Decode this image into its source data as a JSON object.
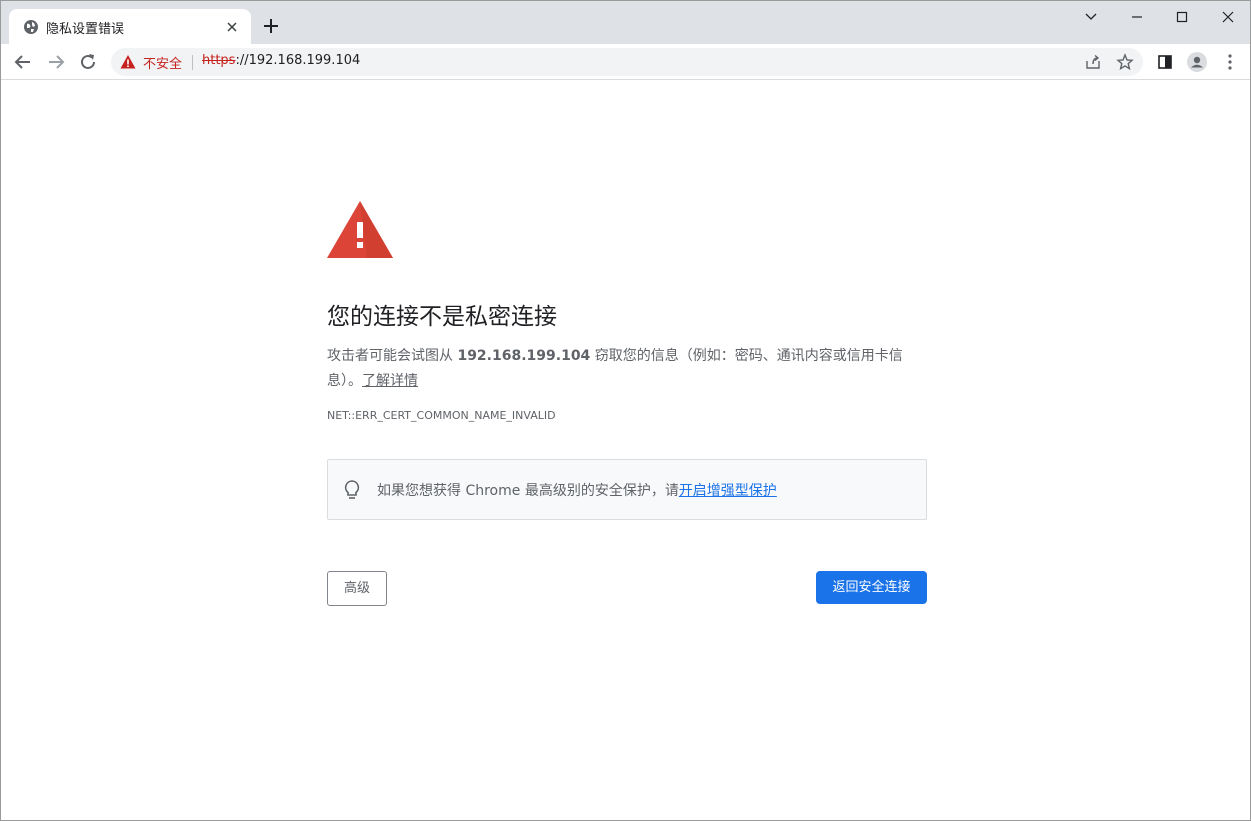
{
  "tab": {
    "title": "隐私设置错误",
    "favicon_icon": "globe-icon",
    "close_icon": "close-icon"
  },
  "window_controls": [
    "chevron-down-icon",
    "minimize-icon",
    "maximize-icon",
    "close-icon"
  ],
  "toolbar": {
    "security_label": "不安全",
    "url_scheme": "https",
    "url_rest": "://192.168.199.104",
    "icons": [
      "back-icon",
      "forward-icon",
      "reload-icon",
      "share-icon",
      "star-icon",
      "side-panel-icon",
      "profile-icon",
      "menu-icon"
    ]
  },
  "page": {
    "heading": "您的连接不是私密连接",
    "desc_prefix": "攻击者可能会试图从 ",
    "desc_host": "192.168.199.104",
    "desc_suffix": " 窃取您的信息（例如：密码、通讯内容或信用卡信息）。",
    "learn_more": "了解详情",
    "error_code": "NET::ERR_CERT_COMMON_NAME_INVALID",
    "promo_text": "如果您想获得 Chrome 最高级别的安全保护，请",
    "promo_link": "开启增强型保护",
    "advanced_button": "高级",
    "back_button": "返回安全连接"
  },
  "colors": {
    "warning_red": "#db4437",
    "link_blue": "#1a73e8",
    "primary_button": "#1a73e8"
  }
}
